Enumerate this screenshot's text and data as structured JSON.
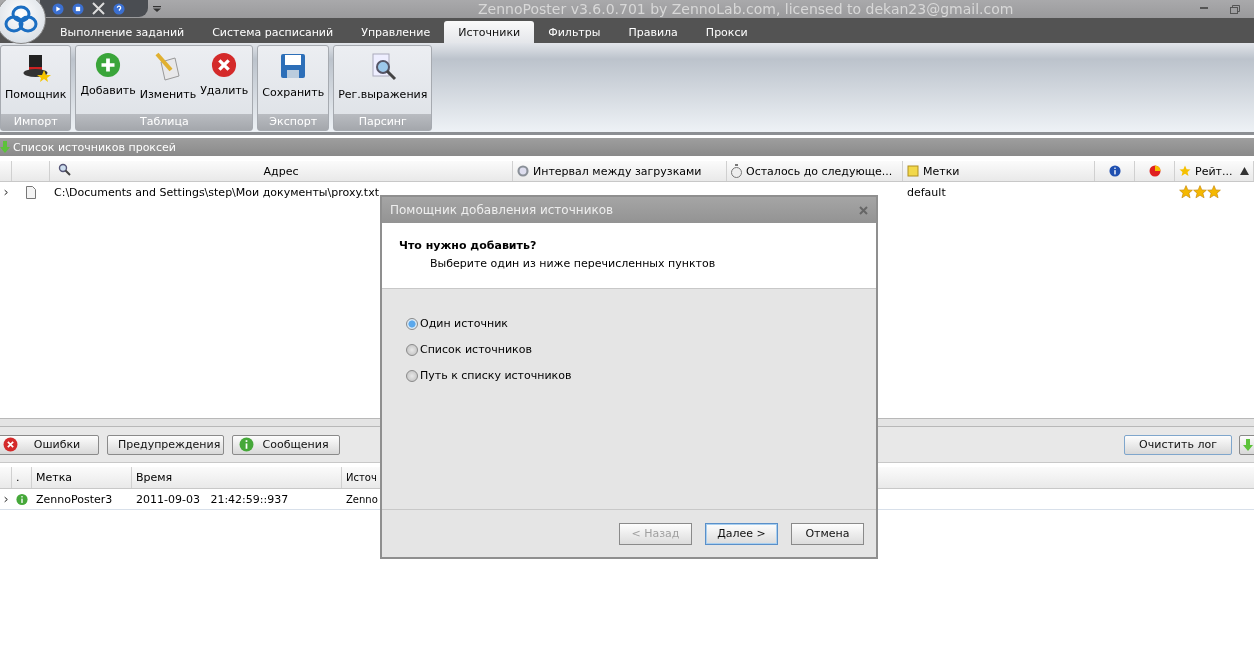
{
  "window": {
    "title": "ZennoPoster v3.6.0.701 by ZennoLab.com, licensed to dekan23@gmail.com"
  },
  "tabs": [
    {
      "label": "Выполнение заданий",
      "selected": false
    },
    {
      "label": "Система расписаний",
      "selected": false
    },
    {
      "label": "Управление",
      "selected": false
    },
    {
      "label": "Источники",
      "selected": true
    },
    {
      "label": "Фильтры",
      "selected": false
    },
    {
      "label": "Правила",
      "selected": false
    },
    {
      "label": "Прокси",
      "selected": false
    }
  ],
  "ribbon_groups": [
    {
      "label": "Импорт",
      "buttons": [
        "Помощник"
      ]
    },
    {
      "label": "Таблица",
      "buttons": [
        "Добавить",
        "Изменить",
        "Удалить"
      ]
    },
    {
      "label": "Экспорт",
      "buttons": [
        "Сохранить"
      ]
    },
    {
      "label": "Парсинг",
      "buttons": [
        "Рег.выражения"
      ]
    }
  ],
  "section_title": "Список источников проксей",
  "table": {
    "columns": [
      "Адрес",
      "Интервал между загрузками",
      "Осталось до следующе...",
      "Метки",
      "Рейт..."
    ],
    "rows": [
      {
        "address": "C:\\Documents and Settings\\step\\Мои документы\\proxy.txt",
        "tags": "default",
        "stars": 3
      }
    ]
  },
  "log_filters": [
    {
      "label": "Ошибки",
      "kind": "error"
    },
    {
      "label": "Предупреждения",
      "kind": "warning"
    },
    {
      "label": "Сообщения",
      "kind": "info"
    }
  ],
  "clear_log": "Очистить лог",
  "log_table": {
    "columns": [
      ".",
      "Метка",
      "Время",
      "Источ"
    ],
    "rows": [
      {
        "kind": "info",
        "label": "ZennoPoster3",
        "time": "2011-09-03   21:42:59::937",
        "source": "Zenno"
      }
    ]
  },
  "dialog": {
    "title": "Помощник добавления источников",
    "heading": "Что нужно добавить?",
    "subheading": "Выберите один из ниже перечисленных пунктов",
    "options": [
      {
        "label": "Один источник",
        "selected": true
      },
      {
        "label": "Список источников",
        "selected": false
      },
      {
        "label": "Путь к списку источников",
        "selected": false
      }
    ],
    "buttons": [
      {
        "label": "< Назад",
        "disabled": true,
        "default": false
      },
      {
        "label": "Далее >",
        "disabled": false,
        "default": true
      },
      {
        "label": "Отмена",
        "disabled": false,
        "default": false
      }
    ]
  }
}
